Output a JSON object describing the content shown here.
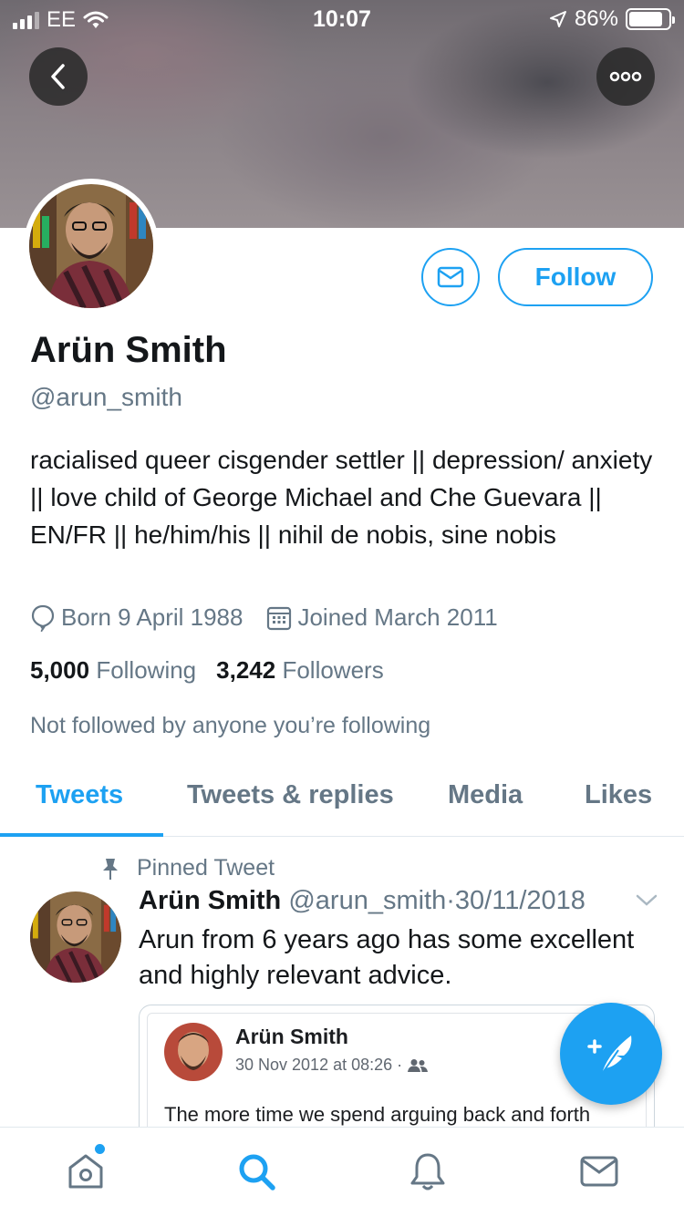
{
  "status_bar": {
    "carrier": "EE",
    "time": "10:07",
    "battery": "86%"
  },
  "profile": {
    "name": "Arün Smith",
    "handle": "@arun_smith",
    "bio": "racialised queer cisgender settler || depression/ anxiety || love child of George Michael and Che Guevara || EN/FR || he/him/his || nihil de nobis, sine nobis",
    "born": "Born 9 April 1988",
    "joined": "Joined March 2011",
    "following_count": "5,000",
    "following_label": "Following",
    "followers_count": "3,242",
    "followers_label": "Followers",
    "not_followed": "Not followed by anyone you’re following",
    "follow_label": "Follow"
  },
  "tabs": [
    {
      "label": "Tweets",
      "active": true
    },
    {
      "label": "Tweets & replies",
      "active": false
    },
    {
      "label": "Media",
      "active": false
    },
    {
      "label": "Likes",
      "active": false
    }
  ],
  "pinned_tweet": {
    "pinned_label": "Pinned Tweet",
    "author": "Arün Smith",
    "handle": "@arun_smith",
    "separator": "·",
    "date": "30/11/2018",
    "text": "Arun from 6 years ago has some excellent and highly relevant advice.",
    "embed": {
      "author": "Arün Smith",
      "date": "30 Nov 2012 at 08:26 ·",
      "text": "The more time we spend arguing back and forth"
    }
  },
  "colors": {
    "accent": "#1da1f2",
    "secondary_text": "#657786",
    "primary_text": "#14171a"
  },
  "icons": {
    "back": "chevron-left-icon",
    "more": "more-icon",
    "message": "envelope-icon",
    "born": "balloon-icon",
    "joined": "calendar-icon",
    "pin": "pin-icon",
    "caret": "chevron-down-icon",
    "compose": "compose-tweet-icon",
    "nav": [
      "home-icon",
      "search-icon",
      "bell-icon",
      "mail-icon"
    ]
  }
}
